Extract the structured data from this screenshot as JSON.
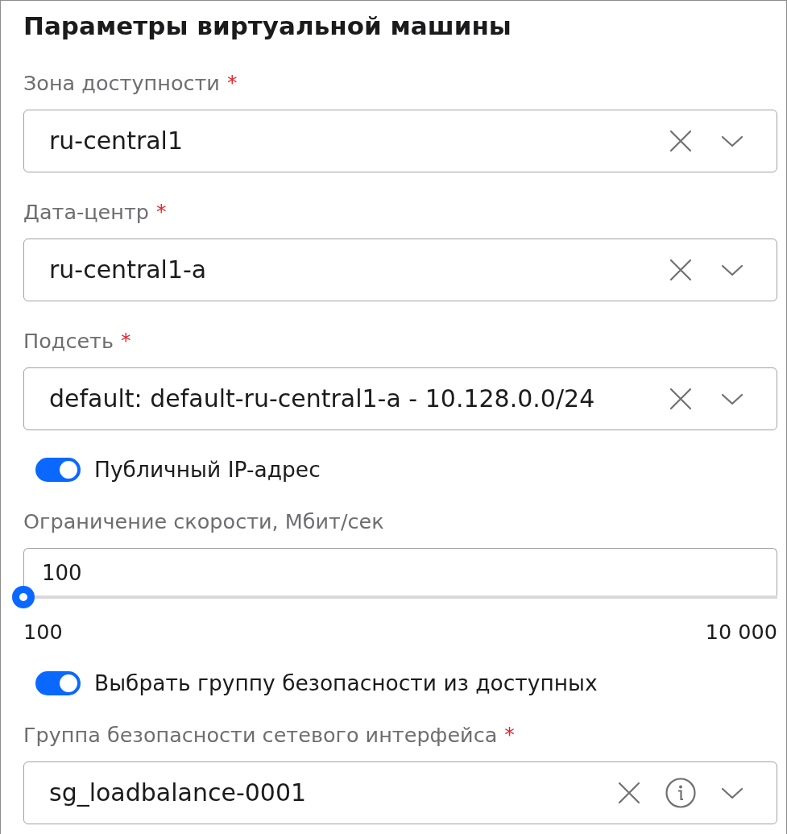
{
  "title": "Параметры виртуальной машины",
  "fields": [
    {
      "kind": "select",
      "label": "Зона доступности",
      "required_mark": "*",
      "value": "ru-central1",
      "info": false
    },
    {
      "kind": "select",
      "label": "Дата-центр",
      "required_mark": "*",
      "value": "ru-central1-a",
      "info": false
    },
    {
      "kind": "select",
      "label": "Подсеть",
      "required_mark": "*",
      "value": "default: default-ru-central1-a - 10.128.0.0/24",
      "info": false
    },
    {
      "kind": "toggle",
      "label": "Публичный IP-адрес",
      "on": true
    },
    {
      "kind": "slider",
      "label": "Ограничение скорости, Мбит/сек",
      "value": "100",
      "level": 0,
      "min_label": "100",
      "max_label": "10 000"
    },
    {
      "kind": "toggle",
      "label": "Выбрать группу безопасности из доступных",
      "on": true
    },
    {
      "kind": "select",
      "label": "Группа безопасности сетевого интерфейса",
      "required_mark": "*",
      "value": "sg_loadbalance-0001",
      "info": true
    }
  ]
}
